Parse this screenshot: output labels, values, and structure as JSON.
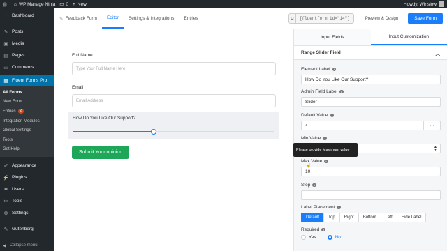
{
  "adminbar": {
    "site_name": "WP Manage Ninja",
    "comments_count": "0",
    "new_label": "New",
    "greeting": "Howdy, Winslow"
  },
  "sidebar": {
    "items_top": [
      {
        "label": "Dashboard",
        "icon": "dashboard-icon"
      }
    ],
    "items_mid": [
      {
        "label": "Posts",
        "icon": "pin-icon"
      },
      {
        "label": "Media",
        "icon": "media-icon"
      },
      {
        "label": "Pages",
        "icon": "page-icon"
      },
      {
        "label": "Comments",
        "icon": "comment-icon"
      }
    ],
    "active": {
      "label": "Fluent Forms Pro",
      "icon": "forms-icon"
    },
    "submenu": [
      {
        "label": "All Forms",
        "current": true
      },
      {
        "label": "New Form"
      },
      {
        "label": "Entries",
        "badge": "2"
      },
      {
        "label": "Integration Modules"
      },
      {
        "label": "Global Settings"
      },
      {
        "label": "Tools"
      },
      {
        "label": "Get Help"
      }
    ],
    "items_bottom": [
      {
        "label": "Appearance",
        "icon": "brush-icon"
      },
      {
        "label": "Plugins",
        "icon": "plugin-icon"
      },
      {
        "label": "Users",
        "icon": "users-icon"
      },
      {
        "label": "Tools",
        "icon": "wrench-icon"
      },
      {
        "label": "Settings",
        "icon": "settings-icon"
      }
    ],
    "gutenberg": "Gutenberg",
    "collapse": "Collapse menu"
  },
  "topbar": {
    "tabs": [
      "Feedback Form",
      "Editor",
      "Settings & Integrations",
      "Entries"
    ],
    "active_tab": "Editor",
    "shortcode": "[fluentform id=\"14\"]",
    "preview_label": "Preview & Design",
    "save_label": "Save Form"
  },
  "form": {
    "name_label": "Full Name",
    "name_placeholder": "Type Your Full Name Here",
    "email_label": "Email",
    "email_placeholder": "Email Address",
    "slider_label": "How Do You Like Our Support?",
    "slider_value": 4,
    "slider_max": 10,
    "submit_label": "Submit Your opinion"
  },
  "panel": {
    "tabs": [
      "Input Fields",
      "Input Customization"
    ],
    "active_tab": "Input Customization",
    "section_title": "Range Slider Field",
    "element_label": {
      "label": "Element Label",
      "value": "How Do You Like Our Support?"
    },
    "admin_label": {
      "label": "Admin Field Label",
      "value": "Slider"
    },
    "default_value": {
      "label": "Default Value",
      "value": "4",
      "dots": "···"
    },
    "min_value": {
      "label": "Min Value",
      "value": ""
    },
    "tooltip": "Please provide Maximum value",
    "max_value": {
      "label": "Max Value",
      "value": "10"
    },
    "step": {
      "label": "Step",
      "value": ""
    },
    "placement": {
      "label": "Label Placement",
      "options": [
        "Default",
        "Top",
        "Right",
        "Bottom",
        "Left",
        "Hide Label"
      ],
      "selected": "Default"
    },
    "required": {
      "label": "Required",
      "options": [
        "Yes",
        "No"
      ],
      "selected": "No"
    }
  },
  "colors": {
    "accent": "#1a7efb",
    "submit": "#1ea659",
    "wp_blue": "#0073aa"
  }
}
